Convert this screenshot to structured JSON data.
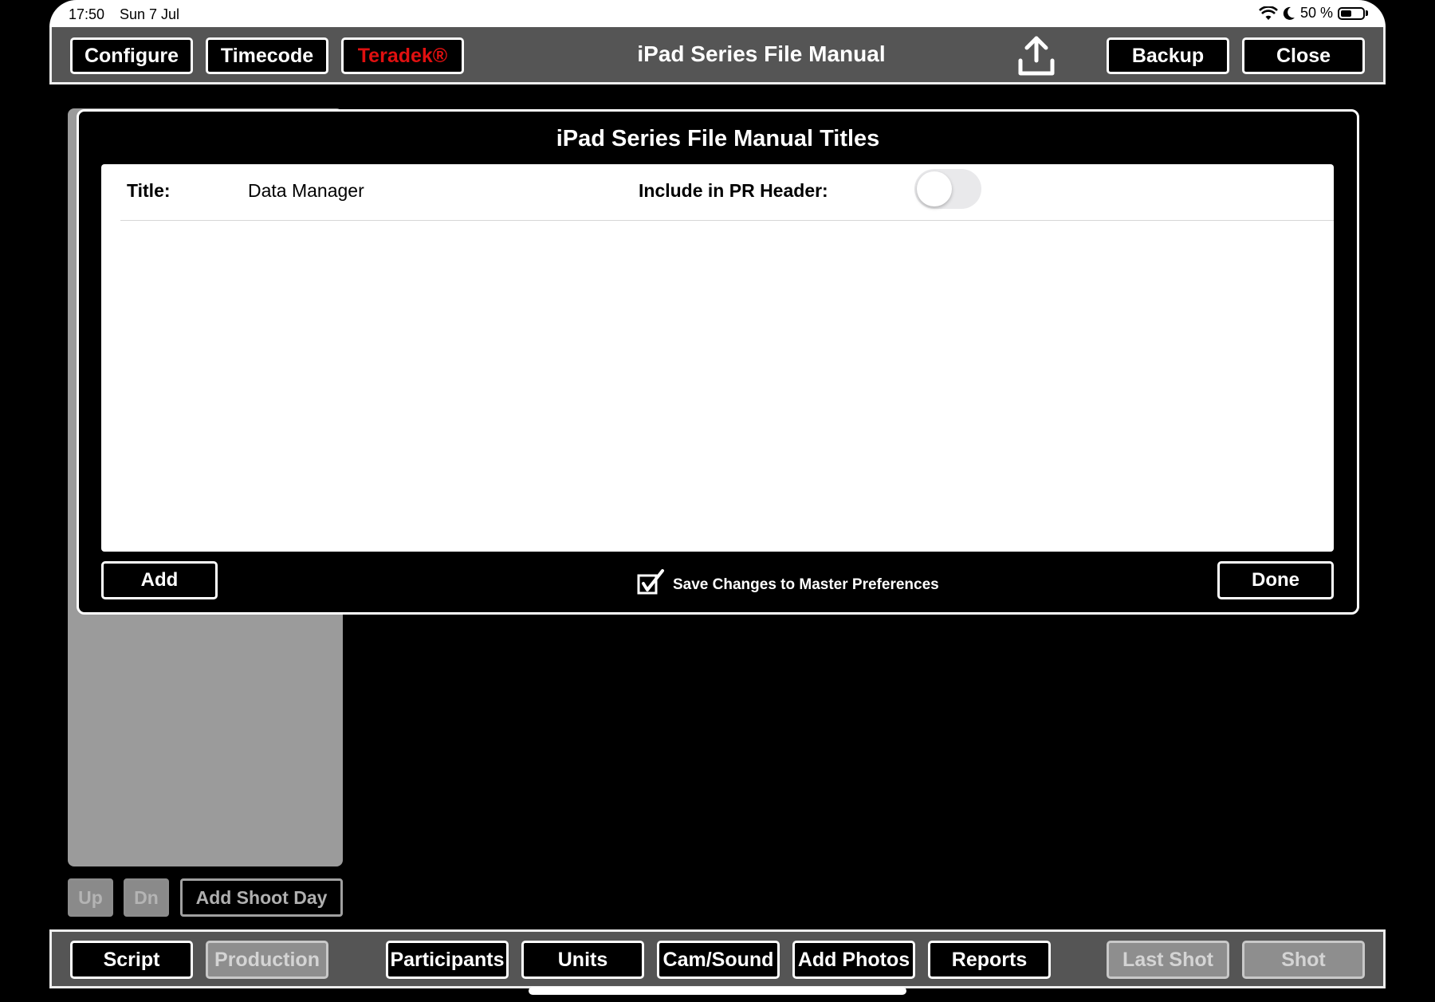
{
  "status_bar": {
    "time": "17:50",
    "date": "Sun 7 Jul",
    "battery_text": "50 %",
    "battery_level": 0.5
  },
  "toolbar": {
    "title": "iPad Series File Manual",
    "configure": "Configure",
    "timecode": "Timecode",
    "teradek": "Teradek®",
    "backup": "Backup",
    "close": "Close",
    "share_icon": "share-upload-icon"
  },
  "side_panel": {
    "up": "Up",
    "dn": "Dn",
    "add_shoot_day": "Add Shoot Day"
  },
  "modal": {
    "title": "iPad Series File Manual Titles",
    "title_label": "Title:",
    "title_value": "Data Manager",
    "include_label": "Include in PR Header:",
    "include_toggle_on": false,
    "add": "Add",
    "save_changes": "Save Changes to Master Preferences",
    "save_checked": true,
    "done": "Done"
  },
  "bottom_bar": {
    "script": "Script",
    "production": "Production",
    "participants": "Participants",
    "units": "Units",
    "cam_sound": "Cam/Sound",
    "add_photos": "Add Photos",
    "reports": "Reports",
    "last_shot": "Last Shot",
    "shot": "Shot"
  },
  "colors": {
    "accent_red": "#e01010",
    "toolbar_bg": "#555555",
    "panel_gray": "#9b9b9b"
  }
}
